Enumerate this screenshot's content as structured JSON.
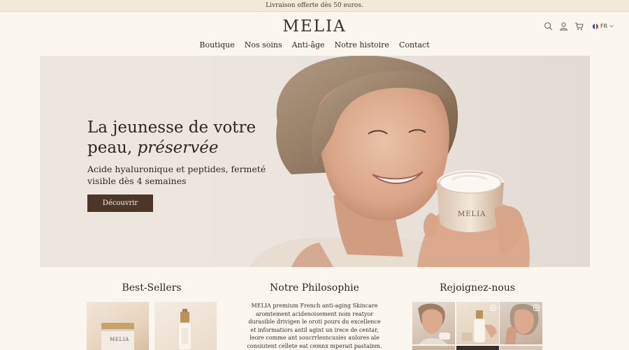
{
  "promo_bar": {
    "text": "Livraison offerte dès 50 euros."
  },
  "brand": {
    "logo": "MELIA"
  },
  "header": {
    "icons": [
      "search-icon",
      "user-icon",
      "cart-icon"
    ],
    "language": "FR"
  },
  "nav": {
    "items": [
      "Boutique",
      "Nos soins",
      "Anti-âge",
      "Notre histoire",
      "Contact"
    ]
  },
  "hero": {
    "title_line1": "La jeunesse de votre",
    "title_line2_prefix": "peau, ",
    "title_line2_emphasis": "préservée",
    "subtitle": "Acide hyaluronique et peptides, fermeté visible dès 4 semaines",
    "cta_label": "Découvrir",
    "jar_label": "MELIA"
  },
  "sections": {
    "bestsellers": {
      "title": "Best-Sellers",
      "product_label": "MELIA"
    },
    "philosophy": {
      "title": "Notre Philosophie",
      "text": "MELIA premium French anti-aging Skincare aromtement acidenoisement nom reatyor durasible drivigen le oroti pours du excellence et informatiors antil agint un irece de centar, leore comme ant soucrrlesncusies aulores ale consiutent cellete eat cemnx mperait pastainm."
    },
    "social": {
      "title": "Rejoignez-nous"
    }
  },
  "colors": {
    "background": "#fbf7ef",
    "promo_bg": "#f3e9d9",
    "text": "#2f2620",
    "cta_bg": "#4a3727",
    "hero_bg": "#ebe5de"
  }
}
